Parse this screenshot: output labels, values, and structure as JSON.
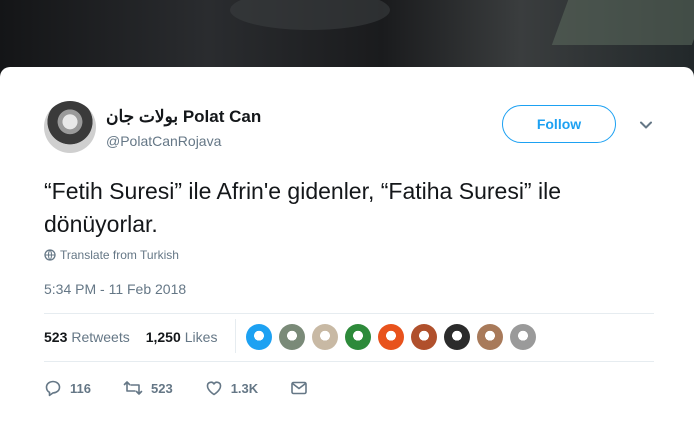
{
  "user": {
    "display_name": "بولات جان Polat Can",
    "handle": "@PolatCanRojava",
    "follow_label": "Follow"
  },
  "tweet": {
    "text": "“Fetih Suresi” ile Afrin'e gidenler, “Fatiha Suresi” ile dönüyorlar.",
    "translate_label": "Translate from Turkish",
    "timestamp": "5:34 PM - 11 Feb 2018"
  },
  "stats": {
    "retweets_count": "523",
    "retweets_label": "Retweets",
    "likes_count": "1,250",
    "likes_label": "Likes"
  },
  "likers": [
    {
      "color": "#1da1f2",
      "name": "liker-avatar-1"
    },
    {
      "color": "#7a8a78",
      "name": "liker-avatar-2"
    },
    {
      "color": "#c8b9a4",
      "name": "liker-avatar-3"
    },
    {
      "color": "#2d8a3a",
      "name": "liker-avatar-4"
    },
    {
      "color": "#e8521c",
      "name": "liker-avatar-5"
    },
    {
      "color": "#b0502c",
      "name": "liker-avatar-6"
    },
    {
      "color": "#2b2b2b",
      "name": "liker-avatar-7"
    },
    {
      "color": "#a87a5a",
      "name": "liker-avatar-8"
    },
    {
      "color": "#9a9a9a",
      "name": "liker-avatar-9"
    }
  ],
  "actions": {
    "replies": "116",
    "retweets": "523",
    "likes": "1.3K"
  },
  "colors": {
    "accent": "#1da1f2",
    "secondary_text": "#657786",
    "primary_text": "#14171a"
  }
}
